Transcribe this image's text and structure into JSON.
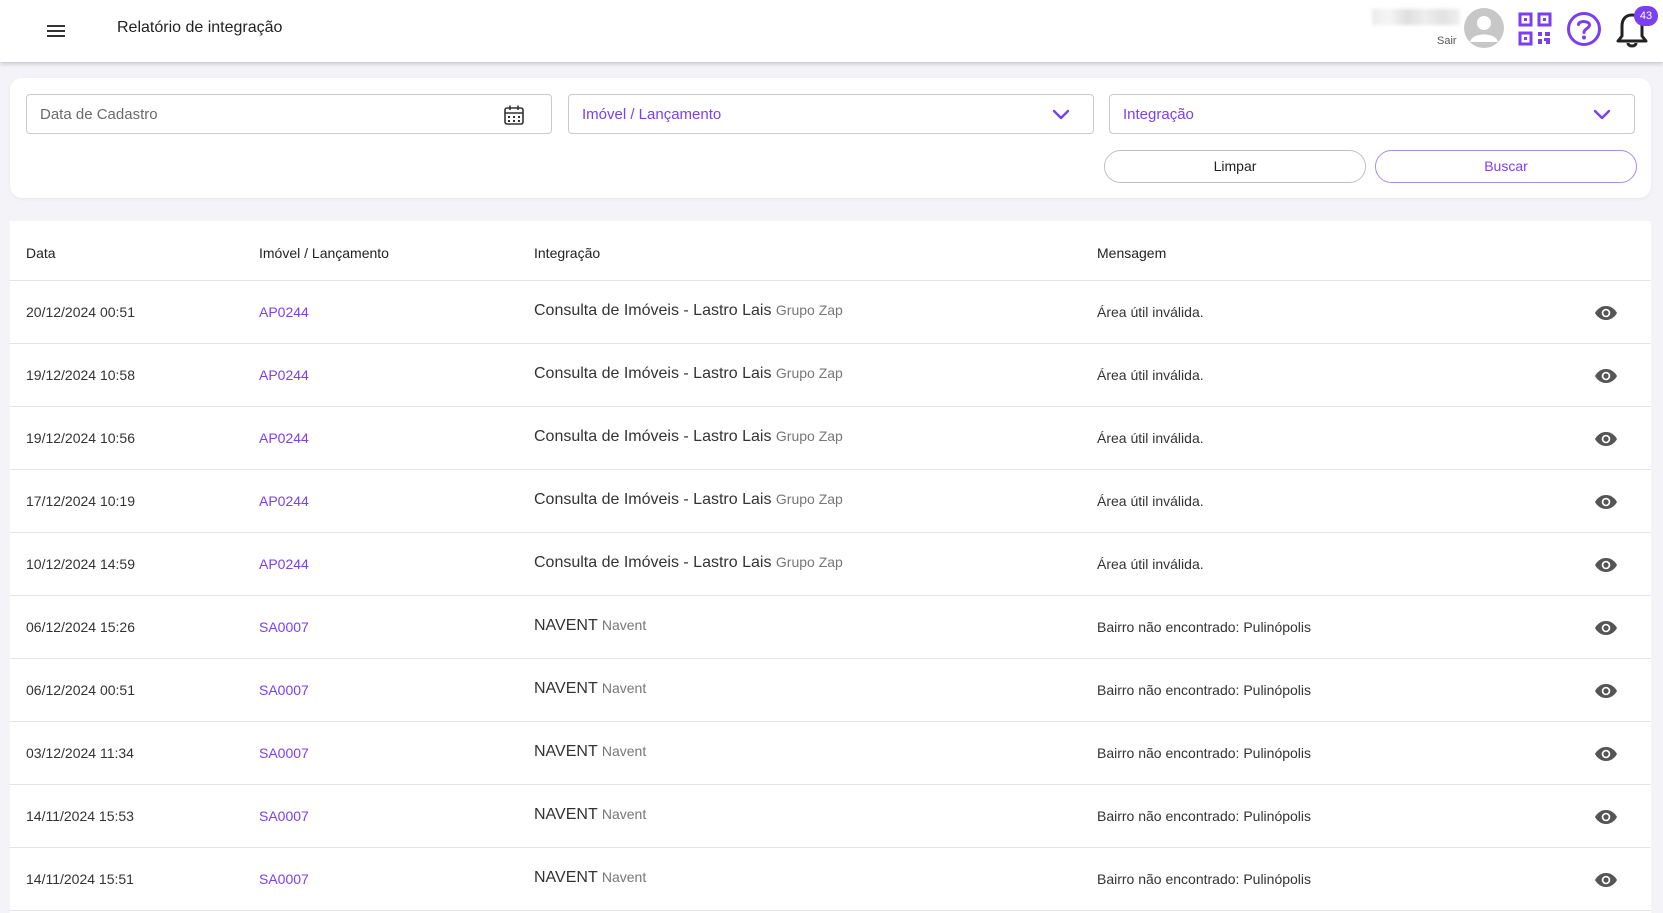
{
  "header": {
    "title": "Relatório de integração",
    "logout_label": "Sair",
    "notification_count": "43"
  },
  "filters": {
    "date_placeholder": "Data de Cadastro",
    "imovel_placeholder": "Imóvel / Lançamento",
    "integracao_placeholder": "Integração",
    "clear_label": "Limpar",
    "search_label": "Buscar"
  },
  "table": {
    "headers": {
      "date": "Data",
      "imovel": "Imóvel / Lançamento",
      "integracao": "Integração",
      "mensagem": "Mensagem"
    },
    "rows": [
      {
        "date": "20/12/2024 00:51",
        "imovel": "AP0244",
        "integracao": "Consulta de Imóveis - Lastro Lais",
        "integracao_sub": "Grupo Zap",
        "mensagem": "Área útil inválida."
      },
      {
        "date": "19/12/2024 10:58",
        "imovel": "AP0244",
        "integracao": "Consulta de Imóveis - Lastro Lais",
        "integracao_sub": "Grupo Zap",
        "mensagem": "Área útil inválida."
      },
      {
        "date": "19/12/2024 10:56",
        "imovel": "AP0244",
        "integracao": "Consulta de Imóveis - Lastro Lais",
        "integracao_sub": "Grupo Zap",
        "mensagem": "Área útil inválida."
      },
      {
        "date": "17/12/2024 10:19",
        "imovel": "AP0244",
        "integracao": "Consulta de Imóveis - Lastro Lais",
        "integracao_sub": "Grupo Zap",
        "mensagem": "Área útil inválida."
      },
      {
        "date": "10/12/2024 14:59",
        "imovel": "AP0244",
        "integracao": "Consulta de Imóveis - Lastro Lais",
        "integracao_sub": "Grupo Zap",
        "mensagem": "Área útil inválida."
      },
      {
        "date": "06/12/2024 15:26",
        "imovel": "SA0007",
        "integracao": "NAVENT",
        "integracao_sub": "Navent",
        "mensagem": "Bairro não encontrado: Pulinópolis"
      },
      {
        "date": "06/12/2024 00:51",
        "imovel": "SA0007",
        "integracao": "NAVENT",
        "integracao_sub": "Navent",
        "mensagem": "Bairro não encontrado: Pulinópolis"
      },
      {
        "date": "03/12/2024 11:34",
        "imovel": "SA0007",
        "integracao": "NAVENT",
        "integracao_sub": "Navent",
        "mensagem": "Bairro não encontrado: Pulinópolis"
      },
      {
        "date": "14/11/2024 15:53",
        "imovel": "SA0007",
        "integracao": "NAVENT",
        "integracao_sub": "Navent",
        "mensagem": "Bairro não encontrado: Pulinópolis"
      },
      {
        "date": "14/11/2024 15:51",
        "imovel": "SA0007",
        "integracao": "NAVENT",
        "integracao_sub": "Navent",
        "mensagem": "Bairro não encontrado: Pulinópolis"
      }
    ]
  },
  "icons": {
    "menu": "hamburger-menu-icon",
    "avatar": "user-avatar-icon",
    "qr": "qr-code-icon",
    "help": "help-circle-icon",
    "notifications": "bell-icon",
    "calendar": "calendar-icon",
    "dropdown": "chevron-down-icon",
    "view": "eye-icon"
  },
  "colors": {
    "accent": "#7b3ff2",
    "background": "#f4f3f8"
  }
}
